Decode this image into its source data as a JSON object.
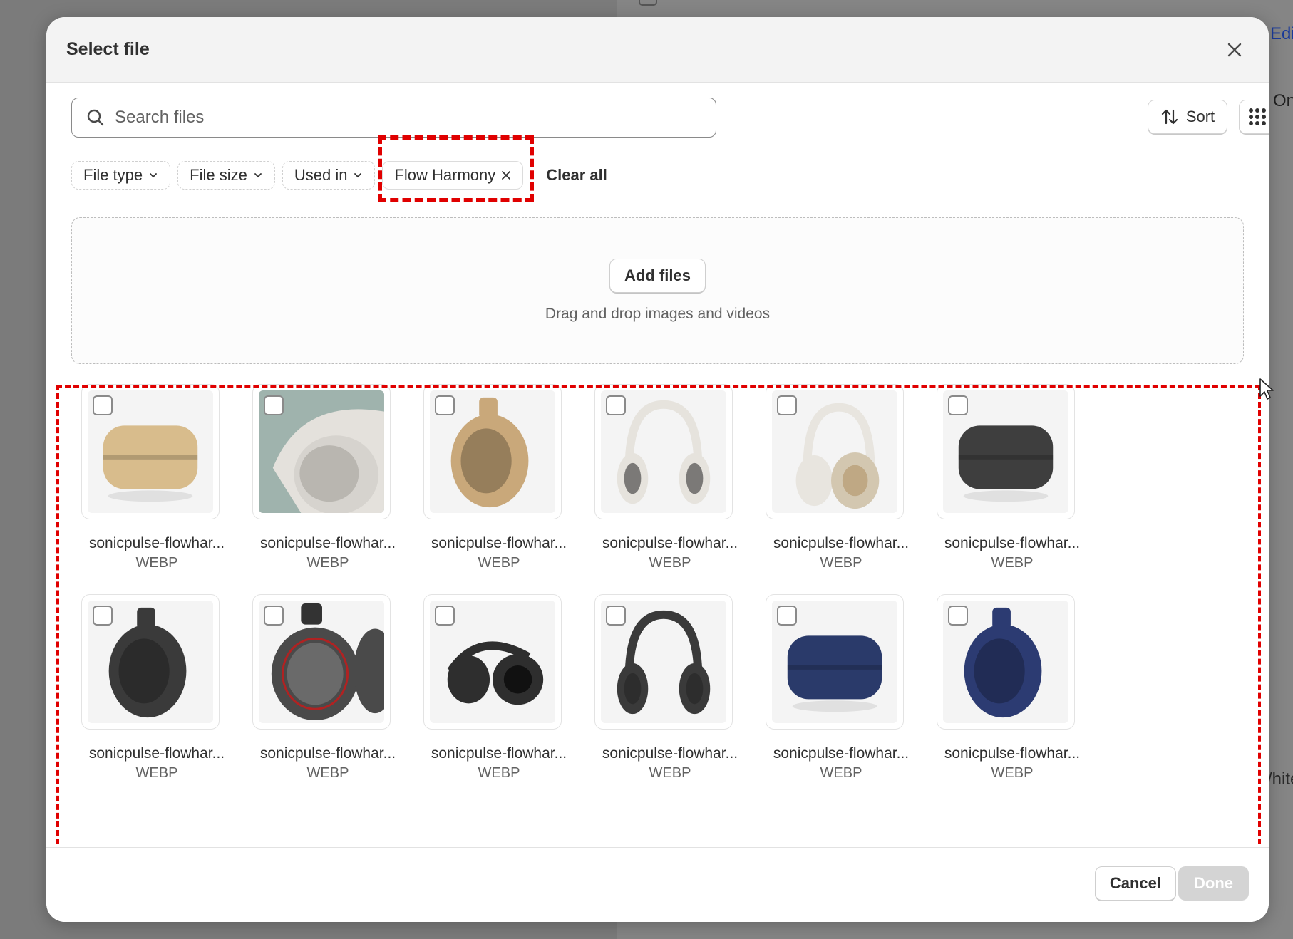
{
  "background": {
    "edit_fragment": "Edi",
    "on_fragment": "On",
    "white_fragment": "/hite"
  },
  "modal": {
    "title": "Select file",
    "close_icon": "close-icon"
  },
  "toolbar": {
    "search_placeholder": "Search files",
    "sort_label": "Sort",
    "view_icon": "grid-view-icon"
  },
  "filters": {
    "file_type": "File type",
    "file_size": "File size",
    "used_in": "Used in",
    "active_filter": "Flow Harmony",
    "clear_all": "Clear all"
  },
  "dropzone": {
    "add_files": "Add files",
    "hint": "Drag and drop images and videos"
  },
  "files": [
    {
      "name": "sonicpulse-flowhar...",
      "type": "WEBP",
      "kind": "case",
      "color": "#d8bc8c"
    },
    {
      "name": "sonicpulse-flowhar...",
      "type": "WEBP",
      "kind": "closeup",
      "color": "#cfcfcf"
    },
    {
      "name": "sonicpulse-flowhar...",
      "type": "WEBP",
      "kind": "cup",
      "color": "#c9a87a"
    },
    {
      "name": "sonicpulse-flowhar...",
      "type": "WEBP",
      "kind": "headphones",
      "color": "#e6e3dd"
    },
    {
      "name": "sonicpulse-flowhar...",
      "type": "WEBP",
      "kind": "headphones-side",
      "color": "#e8e5df"
    },
    {
      "name": "sonicpulse-flowhar...",
      "type": "WEBP",
      "kind": "case",
      "color": "#3e3e3e"
    },
    {
      "name": "sonicpulse-flowhar...",
      "type": "WEBP",
      "kind": "cup",
      "color": "#3a3a3a"
    },
    {
      "name": "sonicpulse-flowhar...",
      "type": "WEBP",
      "kind": "cup-red",
      "color": "#4a4a4a"
    },
    {
      "name": "sonicpulse-flowhar...",
      "type": "WEBP",
      "kind": "headphones-flat",
      "color": "#2e2e2e"
    },
    {
      "name": "sonicpulse-flowhar...",
      "type": "WEBP",
      "kind": "headphones",
      "color": "#3a3a3a"
    },
    {
      "name": "sonicpulse-flowhar...",
      "type": "WEBP",
      "kind": "case",
      "color": "#2a3a6a"
    },
    {
      "name": "sonicpulse-flowhar...",
      "type": "WEBP",
      "kind": "cup",
      "color": "#2c3b72"
    }
  ],
  "footer": {
    "cancel": "Cancel",
    "done": "Done"
  }
}
